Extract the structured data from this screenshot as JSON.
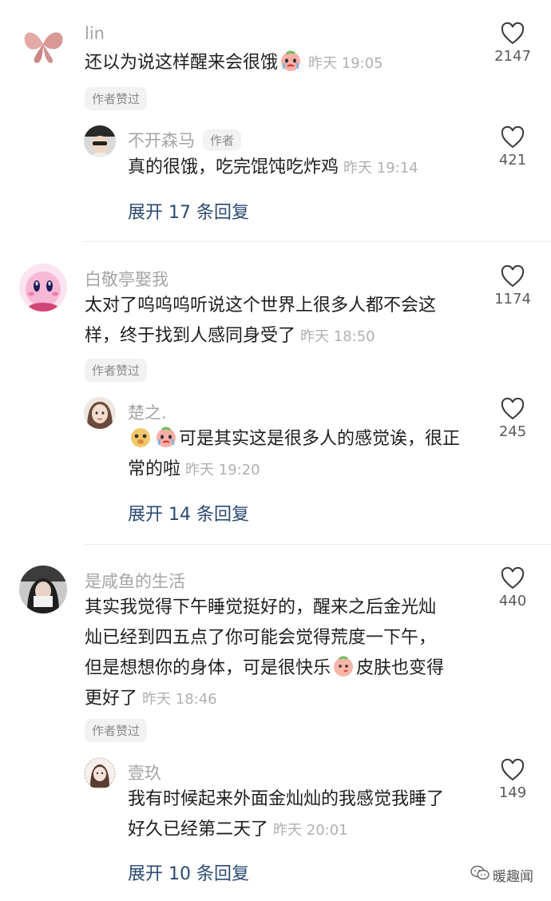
{
  "comments": [
    {
      "user": "lin",
      "text_before_emoji": "还以为说这样醒来会很饿",
      "text_after_emoji": "",
      "time": "昨天 19:05",
      "likes": "2147",
      "badge": "作者赞过",
      "reply": {
        "user": "不开森马",
        "author_tag": "作者",
        "text": "真的很饿，吃完馄饨吃炸鸡",
        "time": "昨天 19:14",
        "likes": "421"
      },
      "expand": "展开 17 条回复"
    },
    {
      "user": "白敬亭娶我",
      "text_line1": "太对了呜呜呜听说这个世界上很多人都不会这",
      "text_line2": "样，终于找到人感同身受了",
      "time": "昨天 18:50",
      "likes": "1174",
      "badge": "作者赞过",
      "reply": {
        "user": "楚之.",
        "text_line1": "可是其实这是很多人的感觉诶，很正",
        "text_line2": "常的啦",
        "time": "昨天 19:20",
        "likes": "245"
      },
      "expand": "展开 14 条回复"
    },
    {
      "user": "是咸鱼的生活",
      "text_line1": "其实我觉得下午睡觉挺好的，醒来之后金光灿",
      "text_line2": "灿已经到四五点了你可能会觉得荒度一下午，",
      "text_line3a": "但是想想你的身体，可是很快乐",
      "text_line3b": "皮肤也变得",
      "text_line4": "更好了",
      "time": "昨天 18:46",
      "likes": "440",
      "badge": "作者赞过",
      "reply": {
        "user": "壹玖",
        "text_line1": "我有时候起来外面金灿灿的我感觉我睡了",
        "text_line2": "好久已经第二天了",
        "time": "昨天 20:01",
        "likes": "149"
      },
      "expand": "展开 10 条回复"
    }
  ],
  "watermark": "暖趣闻",
  "colors": {
    "expand_link": "#2b4a72",
    "muted": "#a4a4a4"
  }
}
